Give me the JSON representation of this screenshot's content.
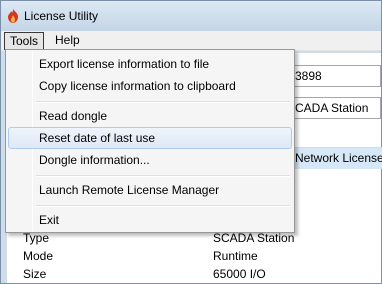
{
  "window": {
    "title": "License Utility"
  },
  "menubar": {
    "tools": "Tools",
    "help": "Help"
  },
  "tools_menu": {
    "items": [
      {
        "label": "Export license information to file"
      },
      {
        "label": "Copy license information to clipboard"
      },
      {
        "label": "Read dongle"
      },
      {
        "label": "Reset date of last use"
      },
      {
        "label": "Dongle information..."
      },
      {
        "label": "Launch Remote License Manager"
      },
      {
        "label": "Exit"
      }
    ],
    "highlighted": "Reset date of last use"
  },
  "background": {
    "field1_suffix": "3898",
    "field2_suffix": "CADA Station",
    "tab_label": "Network Licenses",
    "details": [
      {
        "key": "Type",
        "value": "SCADA Station"
      },
      {
        "key": "Mode",
        "value": "Runtime"
      },
      {
        "key": "Size",
        "value": "65000 I/O"
      }
    ]
  },
  "colors": {
    "titlebar": "#c4d5e6",
    "menu_bg": "#f5f5f5",
    "highlight_border": "#aeccef",
    "tab_highlight": "#d6e8f8"
  }
}
